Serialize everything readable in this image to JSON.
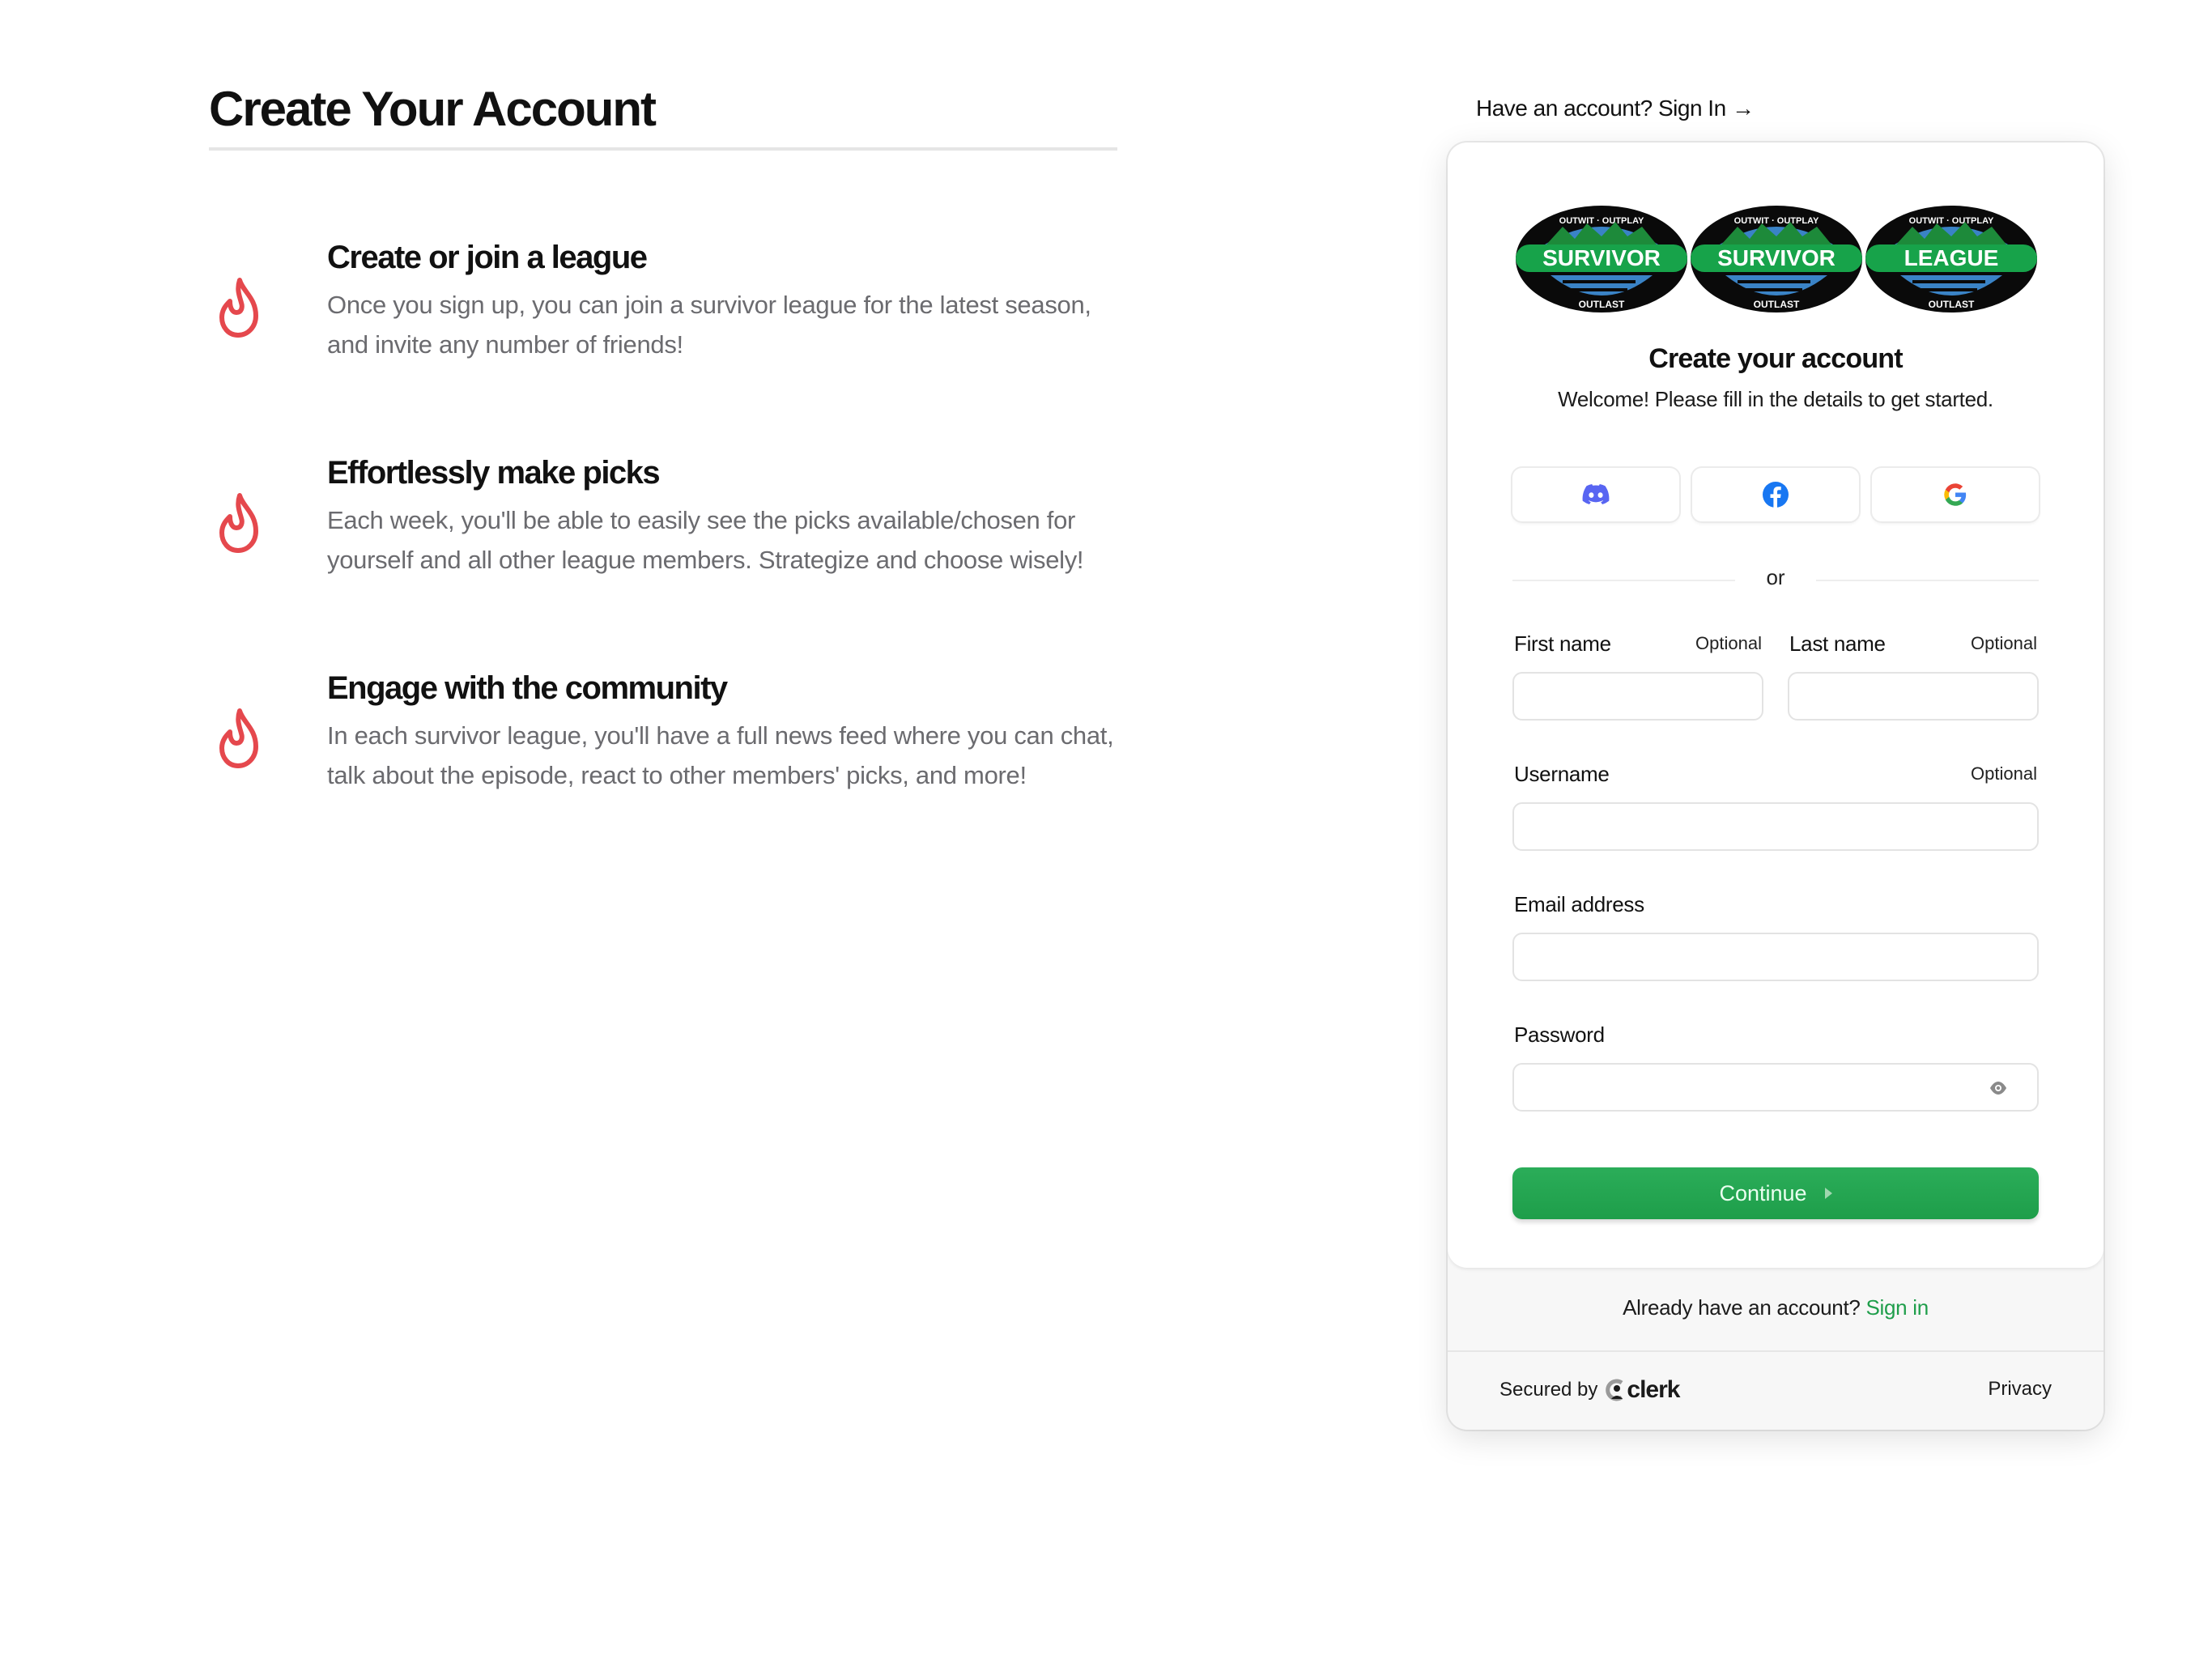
{
  "page": {
    "title": "Create Your Account",
    "features": [
      {
        "icon": "flame-icon",
        "heading": "Create or join a league",
        "body": "Once you sign up, you can join a survivor league for the latest season, and invite any number of friends!"
      },
      {
        "icon": "flame-icon",
        "heading": "Effortlessly make picks",
        "body": "Each week, you'll be able to easily see the picks available/chosen for yourself and all other league members. Strategize and choose wisely!"
      },
      {
        "icon": "flame-icon",
        "heading": "Engage with the community",
        "body": "In each survivor league, you'll have a full news feed where you can chat, talk about the episode, react to other members' picks, and more!"
      }
    ],
    "top_signin_link": "Have an account? Sign In →"
  },
  "card": {
    "logos": [
      {
        "top": "OUTWIT · OUTPLAY",
        "band": "SURVIVOR",
        "bottom": "OUTLAST"
      },
      {
        "top": "OUTWIT · OUTPLAY",
        "band": "SURVIVOR",
        "bottom": "OUTLAST"
      },
      {
        "top": "OUTWIT · OUTPLAY",
        "band": "LEAGUE",
        "bottom": "OUTLAST"
      }
    ],
    "title": "Create your account",
    "subtitle": "Welcome! Please fill in the details to get started.",
    "social": [
      {
        "provider": "Discord",
        "icon": "discord-icon"
      },
      {
        "provider": "Facebook",
        "icon": "facebook-icon"
      },
      {
        "provider": "Google",
        "icon": "google-icon"
      }
    ],
    "divider_text": "or",
    "fields": {
      "first_name": {
        "label": "First name",
        "optional": "Optional",
        "value": "",
        "placeholder": ""
      },
      "last_name": {
        "label": "Last name",
        "optional": "Optional",
        "value": "",
        "placeholder": ""
      },
      "username": {
        "label": "Username",
        "optional": "Optional",
        "value": "",
        "placeholder": ""
      },
      "email": {
        "label": "Email address",
        "value": "",
        "placeholder": ""
      },
      "password": {
        "label": "Password",
        "value": "",
        "placeholder": ""
      }
    },
    "continue_label": "Continue",
    "footer": {
      "already_text": "Already have an account?",
      "signin_link": "Sign in",
      "secured_by": "Secured by",
      "clerk_brand": "clerk",
      "privacy": "Privacy"
    }
  },
  "colors": {
    "accent_green": "#1f9e4b",
    "flame_red": "#e5484d",
    "discord": "#5865f2",
    "facebook": "#1877f2"
  }
}
